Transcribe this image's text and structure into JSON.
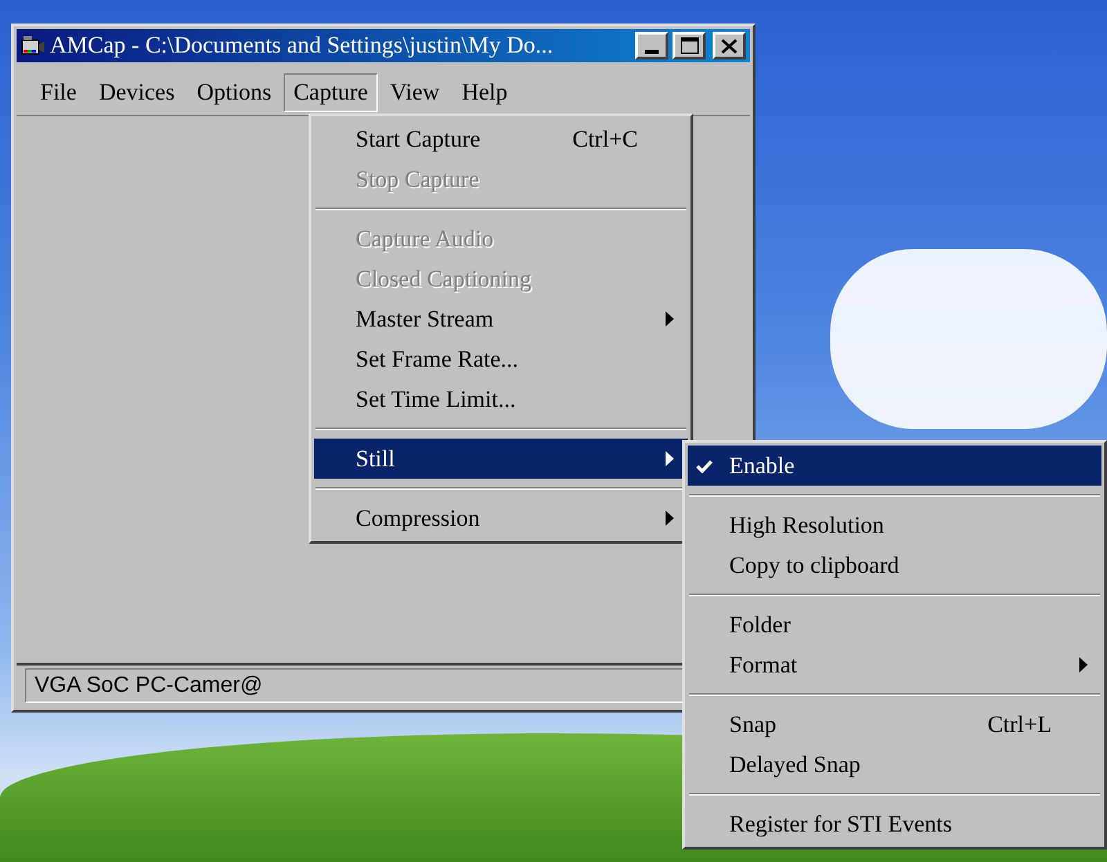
{
  "window": {
    "title": "AMCap - C:\\Documents and Settings\\justin\\My Do..."
  },
  "menu_bar": [
    {
      "label": "File",
      "selected": false
    },
    {
      "label": "Devices",
      "selected": false
    },
    {
      "label": "Options",
      "selected": false
    },
    {
      "label": "Capture",
      "selected": true
    },
    {
      "label": "View",
      "selected": false
    },
    {
      "label": "Help",
      "selected": false
    }
  ],
  "capture_menu": [
    {
      "kind": "item",
      "label": "Start Capture",
      "shortcut": "Ctrl+C",
      "disabled": false,
      "selected": false,
      "submenu": false
    },
    {
      "kind": "item",
      "label": "Stop Capture",
      "disabled": true,
      "selected": false,
      "submenu": false
    },
    {
      "kind": "separator"
    },
    {
      "kind": "item",
      "label": "Capture Audio",
      "disabled": true,
      "selected": false,
      "submenu": false
    },
    {
      "kind": "item",
      "label": "Closed Captioning",
      "disabled": true,
      "selected": false,
      "submenu": false
    },
    {
      "kind": "item",
      "label": "Master Stream",
      "disabled": false,
      "selected": false,
      "submenu": true
    },
    {
      "kind": "item",
      "label": "Set Frame Rate...",
      "disabled": false,
      "selected": false,
      "submenu": false
    },
    {
      "kind": "item",
      "label": "Set Time Limit...",
      "disabled": false,
      "selected": false,
      "submenu": false
    },
    {
      "kind": "separator"
    },
    {
      "kind": "item",
      "label": "Still",
      "disabled": false,
      "selected": true,
      "submenu": true
    },
    {
      "kind": "separator"
    },
    {
      "kind": "item",
      "label": "Compression",
      "disabled": false,
      "selected": false,
      "submenu": true
    }
  ],
  "still_menu": [
    {
      "kind": "item",
      "label": "Enable",
      "checked": true,
      "selected": true,
      "submenu": false
    },
    {
      "kind": "separator"
    },
    {
      "kind": "item",
      "label": "High Resolution",
      "checked": false,
      "selected": false,
      "submenu": false
    },
    {
      "kind": "item",
      "label": "Copy to clipboard",
      "checked": false,
      "selected": false,
      "submenu": false
    },
    {
      "kind": "separator"
    },
    {
      "kind": "item",
      "label": "Folder",
      "checked": false,
      "selected": false,
      "submenu": false
    },
    {
      "kind": "item",
      "label": "Format",
      "checked": false,
      "selected": false,
      "submenu": true
    },
    {
      "kind": "separator"
    },
    {
      "kind": "item",
      "label": "Snap",
      "shortcut": "Ctrl+L",
      "checked": false,
      "selected": false,
      "submenu": false
    },
    {
      "kind": "item",
      "label": "Delayed Snap",
      "checked": false,
      "selected": false,
      "submenu": false
    },
    {
      "kind": "separator"
    },
    {
      "kind": "item",
      "label": "Register for STI Events",
      "checked": false,
      "selected": false,
      "submenu": false
    }
  ],
  "status_bar": {
    "text": "VGA SoC PC-Camer@"
  }
}
